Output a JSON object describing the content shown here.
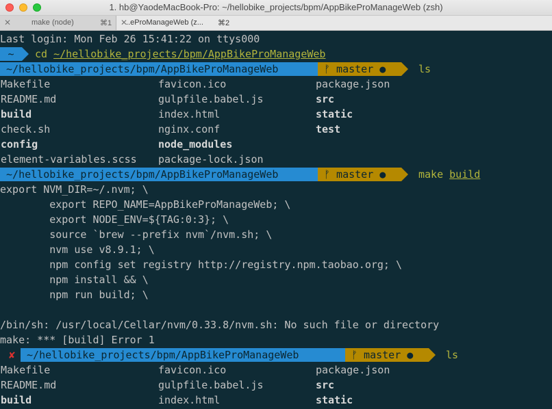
{
  "window": {
    "title": "1. hb@YaodeMacBook-Pro: ~/hellobike_projects/bpm/AppBikeProManageWeb (zsh)"
  },
  "tabs": [
    {
      "label": "make (node)",
      "shortcut": "⌘1",
      "close": "✕"
    },
    {
      "label": "..eProManageWeb (z...",
      "shortcut": "⌘2",
      "close": "✕"
    }
  ],
  "terminal": {
    "last_login": "Last login: Mon Feb 26 15:41:22 on ttys000",
    "prompt0": {
      "dir_segment": " ~ ",
      "cmd": "cd",
      "arg": "~/hellobike_projects/bpm/AppBikeProManageWeb"
    },
    "prompt1": {
      "dir_segment": " ~/hellobike_projects/bpm/AppBikeProManageWeb ",
      "git_segment": " ᚠ master ● ",
      "cmd": "ls"
    },
    "ls1": [
      [
        "Makefile",
        "favicon.ico",
        "package.json"
      ],
      [
        "README.md",
        "gulpfile.babel.js",
        "src"
      ],
      [
        "build",
        "index.html",
        "static"
      ],
      [
        "check.sh",
        "nginx.conf",
        "test"
      ],
      [
        "config",
        "node_modules",
        ""
      ],
      [
        "element-variables.scss",
        "package-lock.json",
        ""
      ]
    ],
    "prompt2": {
      "dir_segment": " ~/hellobike_projects/bpm/AppBikeProManageWeb ",
      "git_segment": " ᚠ master ● ",
      "cmd": "make",
      "arg": "build"
    },
    "make_output": [
      "export NVM_DIR=~/.nvm; \\",
      "        export REPO_NAME=AppBikeProManageWeb; \\",
      "        export NODE_ENV=${TAG:0:3}; \\",
      "        source `brew --prefix nvm`/nvm.sh; \\",
      "        nvm use v8.9.1; \\",
      "        npm config set registry http://registry.npm.taobao.org; \\",
      "        npm install && \\",
      "        npm run build; \\",
      "",
      "/bin/sh: /usr/local/Cellar/nvm/0.33.8/nvm.sh: No such file or directory",
      "make: *** [build] Error 1"
    ],
    "prompt3": {
      "error_mark": " ✘ ",
      "dir_segment": " ~/hellobike_projects/bpm/AppBikeProManageWeb ",
      "git_segment": " ᚠ master ● ",
      "cmd": "ls"
    },
    "ls2": [
      [
        "Makefile",
        "favicon.ico",
        "package.json"
      ],
      [
        "README.md",
        "gulpfile.babel.js",
        "src"
      ],
      [
        "build",
        "index.html",
        "static"
      ]
    ]
  }
}
